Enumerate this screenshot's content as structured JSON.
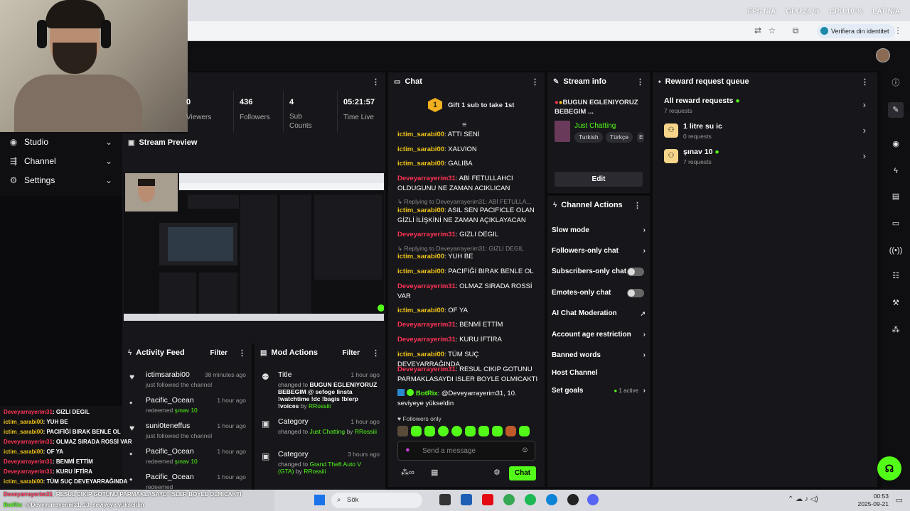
{
  "browser": {
    "stats": [
      "FPS N/A",
      "GPU 24 %",
      "CPU 10 %",
      "LAT N/A"
    ],
    "verify_label": "Verifiera din identitet"
  },
  "nav": {
    "items": [
      {
        "label": "Studio",
        "icon": "studio-icon"
      },
      {
        "label": "Channel",
        "icon": "channel-icon"
      },
      {
        "label": "Settings",
        "icon": "gear-icon"
      }
    ]
  },
  "stats_panel": {
    "stats": [
      {
        "value": "0",
        "label": "Viewers"
      },
      {
        "value": "436",
        "label": "Followers"
      },
      {
        "value": "4",
        "label": "Sub Counts"
      },
      {
        "value": "05:21:57",
        "label": "Time Live"
      }
    ]
  },
  "preview": {
    "title": "Stream Preview"
  },
  "activity": {
    "title": "Activity Feed",
    "filter": "Filter",
    "items": [
      {
        "name": "ictimsarabi00",
        "time": "38 minutes ago",
        "sub": "just followed the channel",
        "icon": "heart-icon"
      },
      {
        "name": "Pacific_Ocean",
        "time": "1 hour ago",
        "sub": "redeemed",
        "reward": "şınav 10",
        "icon": "redeem-icon"
      },
      {
        "name": "suni0teneffus",
        "time": "1 hour ago",
        "sub": "just followed the channel",
        "icon": "heart-icon"
      },
      {
        "name": "Pacific_Ocean",
        "time": "1 hour ago",
        "sub": "redeemed",
        "reward": "şınav 10",
        "icon": "redeem-icon"
      },
      {
        "name": "Pacific_Ocean",
        "time": "1 hour ago",
        "sub": "redeemed",
        "reward": "",
        "icon": "redeem-icon"
      }
    ]
  },
  "mod": {
    "title": "Mod Actions",
    "filter": "Filter",
    "items": [
      {
        "name": "Title",
        "time": "1 hour ago",
        "prefix": "changed to",
        "value": "BUGUN EGLENIYORUZ BEBEGIM @ sefoge linsta !watchtime !dc !bagis !blerp !voices",
        "by": "by",
        "user": "RRossiii"
      },
      {
        "name": "Category",
        "time": "1 hour ago",
        "prefix": "changed to",
        "value": "Just Chatting",
        "by": "by",
        "user": "RRossiii"
      },
      {
        "name": "Category",
        "time": "3 hours ago",
        "prefix": "changed to",
        "value": "Grand Theft Auto V (GTA)",
        "by": "by",
        "user": "RRossiii"
      }
    ]
  },
  "overlay_chat": [
    {
      "user": "Deveyarrayerim31",
      "msg": ": GIZLI DEGIL",
      "color": "red"
    },
    {
      "user": "ictim_sarabi00",
      "msg": ": YUH BE",
      "color": "yel"
    },
    {
      "user": "ictim_sarabi00",
      "msg": ": PACIFİĞİ BIRAK BENLE OL",
      "color": "yel"
    },
    {
      "user": "Deveyarrayerim31",
      "msg": ": OLMAZ SIRADA ROSSİ VAR",
      "color": "red"
    },
    {
      "user": "ictim_sarabi00",
      "msg": ": OF YA",
      "color": "yel"
    },
    {
      "user": "Deveyarrayerim31",
      "msg": ": BENMİ ETTİM",
      "color": "red"
    },
    {
      "user": "Deveyarrayerim31",
      "msg": ": KURU İFTİRA",
      "color": "red"
    },
    {
      "user": "ictim_sarabi00",
      "msg": ": TÜM SUÇ DEVEYARRAĞINDA",
      "color": "yel"
    },
    {
      "user": "Deveyarrayerim31",
      "msg": ": RESUL CIKIP GOTUNU PARMAKLASAYDI ISLER BOYLE OLMICAKTI",
      "color": "red"
    },
    {
      "user": "BotRix",
      "msg": ": @Deveyarrayerim31, 10. seviyeye yükseldin",
      "color": "green"
    }
  ],
  "chat": {
    "title": "Chat",
    "gift": "Gift 1 sub to take 1st",
    "gift_rank": "1",
    "messages": [
      {
        "user": "ictim_sarabi00",
        "msg": ": ATTI SENİ",
        "color": "yel"
      },
      {
        "user": "ictim_sarabi00",
        "msg": ": XALVION",
        "color": "yel"
      },
      {
        "user": "ictim_sarabi00",
        "msg": ": GALIBA",
        "color": "yel"
      },
      {
        "user": "Deveyarrayerim31",
        "msg": ": ABİ FETULLAHCI OLDUGUNU NE ZAMAN ACIKLICAN",
        "color": "red"
      },
      {
        "user": "ictim_sarabi00",
        "msg": ": ASIL SEN PACIFICLE OLAN GİZLİ İLİŞKİNİ NE ZAMAN AÇIKLAYACAN",
        "color": "yel",
        "reply": "Replying to Deveyarrayerim31: ABİ FETULLA..."
      },
      {
        "user": "Deveyarrayerim31",
        "msg": ": GIZLI DEGIL",
        "color": "red"
      },
      {
        "user": "ictim_sarabi00",
        "msg": ": YUH BE",
        "color": "yel",
        "reply": "Replying to Deveyarrayerim31: GIZLI DEGIL"
      },
      {
        "user": "ictim_sarabi00",
        "msg": ": PACIFİĞİ BIRAK BENLE OL",
        "color": "yel"
      },
      {
        "user": "Deveyarrayerim31",
        "msg": ": OLMAZ SIRADA ROSSİ VAR",
        "color": "red"
      },
      {
        "user": "ictim_sarabi00",
        "msg": ": OF YA",
        "color": "yel"
      },
      {
        "user": "Deveyarrayerim31",
        "msg": ": BENMİ ETTİM",
        "color": "red"
      },
      {
        "user": "Deveyarrayerim31",
        "msg": ": KURU İFTİRA",
        "color": "red"
      },
      {
        "user": "ictim_sarabi00",
        "msg": ": TÜM SUÇ DEVEYARRAĞINDA",
        "color": "yel"
      },
      {
        "user": "Deveyarrayerim31",
        "msg": ": RESUL CIKIP GOTUNU PARMAKLASAYDI ISLER BOYLE OLMICAKTI",
        "color": "red"
      },
      {
        "user": "BotRix",
        "msg": ": @Deveyarrayerim31, 10. seviyeye yükseldin",
        "color": "green"
      }
    ],
    "followers_only": "Followers only",
    "placeholder": "Send a message",
    "send": "Chat"
  },
  "stream_info": {
    "title": "Stream info",
    "stream_title": "BUGUN EGLENIYORUZ BEBEGIM ...",
    "category": "Just Chatting",
    "tags": [
      "Turkish",
      "Türkçe",
      "E"
    ],
    "edit": "Edit"
  },
  "channel_actions": {
    "title": "Channel Actions",
    "rows": [
      {
        "label": "Slow mode",
        "type": "chevron"
      },
      {
        "label": "Followers-only chat",
        "type": "chevron"
      },
      {
        "label": "Subscribers-only chat",
        "type": "toggle"
      },
      {
        "label": "Emotes-only chat",
        "type": "toggle"
      },
      {
        "label": "AI Chat Moderation",
        "type": "external"
      },
      {
        "label": "Account age restriction",
        "type": "chevron"
      },
      {
        "label": "Banned words",
        "type": "chevron"
      },
      {
        "label": "Host Channel",
        "type": "none"
      },
      {
        "label": "Set goals",
        "type": "chevron",
        "badge": "1 active"
      }
    ]
  },
  "reward_queue": {
    "title": "Reward request queue",
    "all": "All reward requests",
    "all_count": "7 requests",
    "items": [
      {
        "name": "1 litre su ic",
        "count": "0 requests"
      },
      {
        "name": "şınav 10",
        "count": "7 requests"
      }
    ]
  },
  "taskbar": {
    "search": "Sök",
    "time": "00:53",
    "date": "2025-09-21"
  },
  "colors": {
    "accent": "#53fc18",
    "red_user": "#ff3355",
    "yellow_user": "#f0c419"
  }
}
